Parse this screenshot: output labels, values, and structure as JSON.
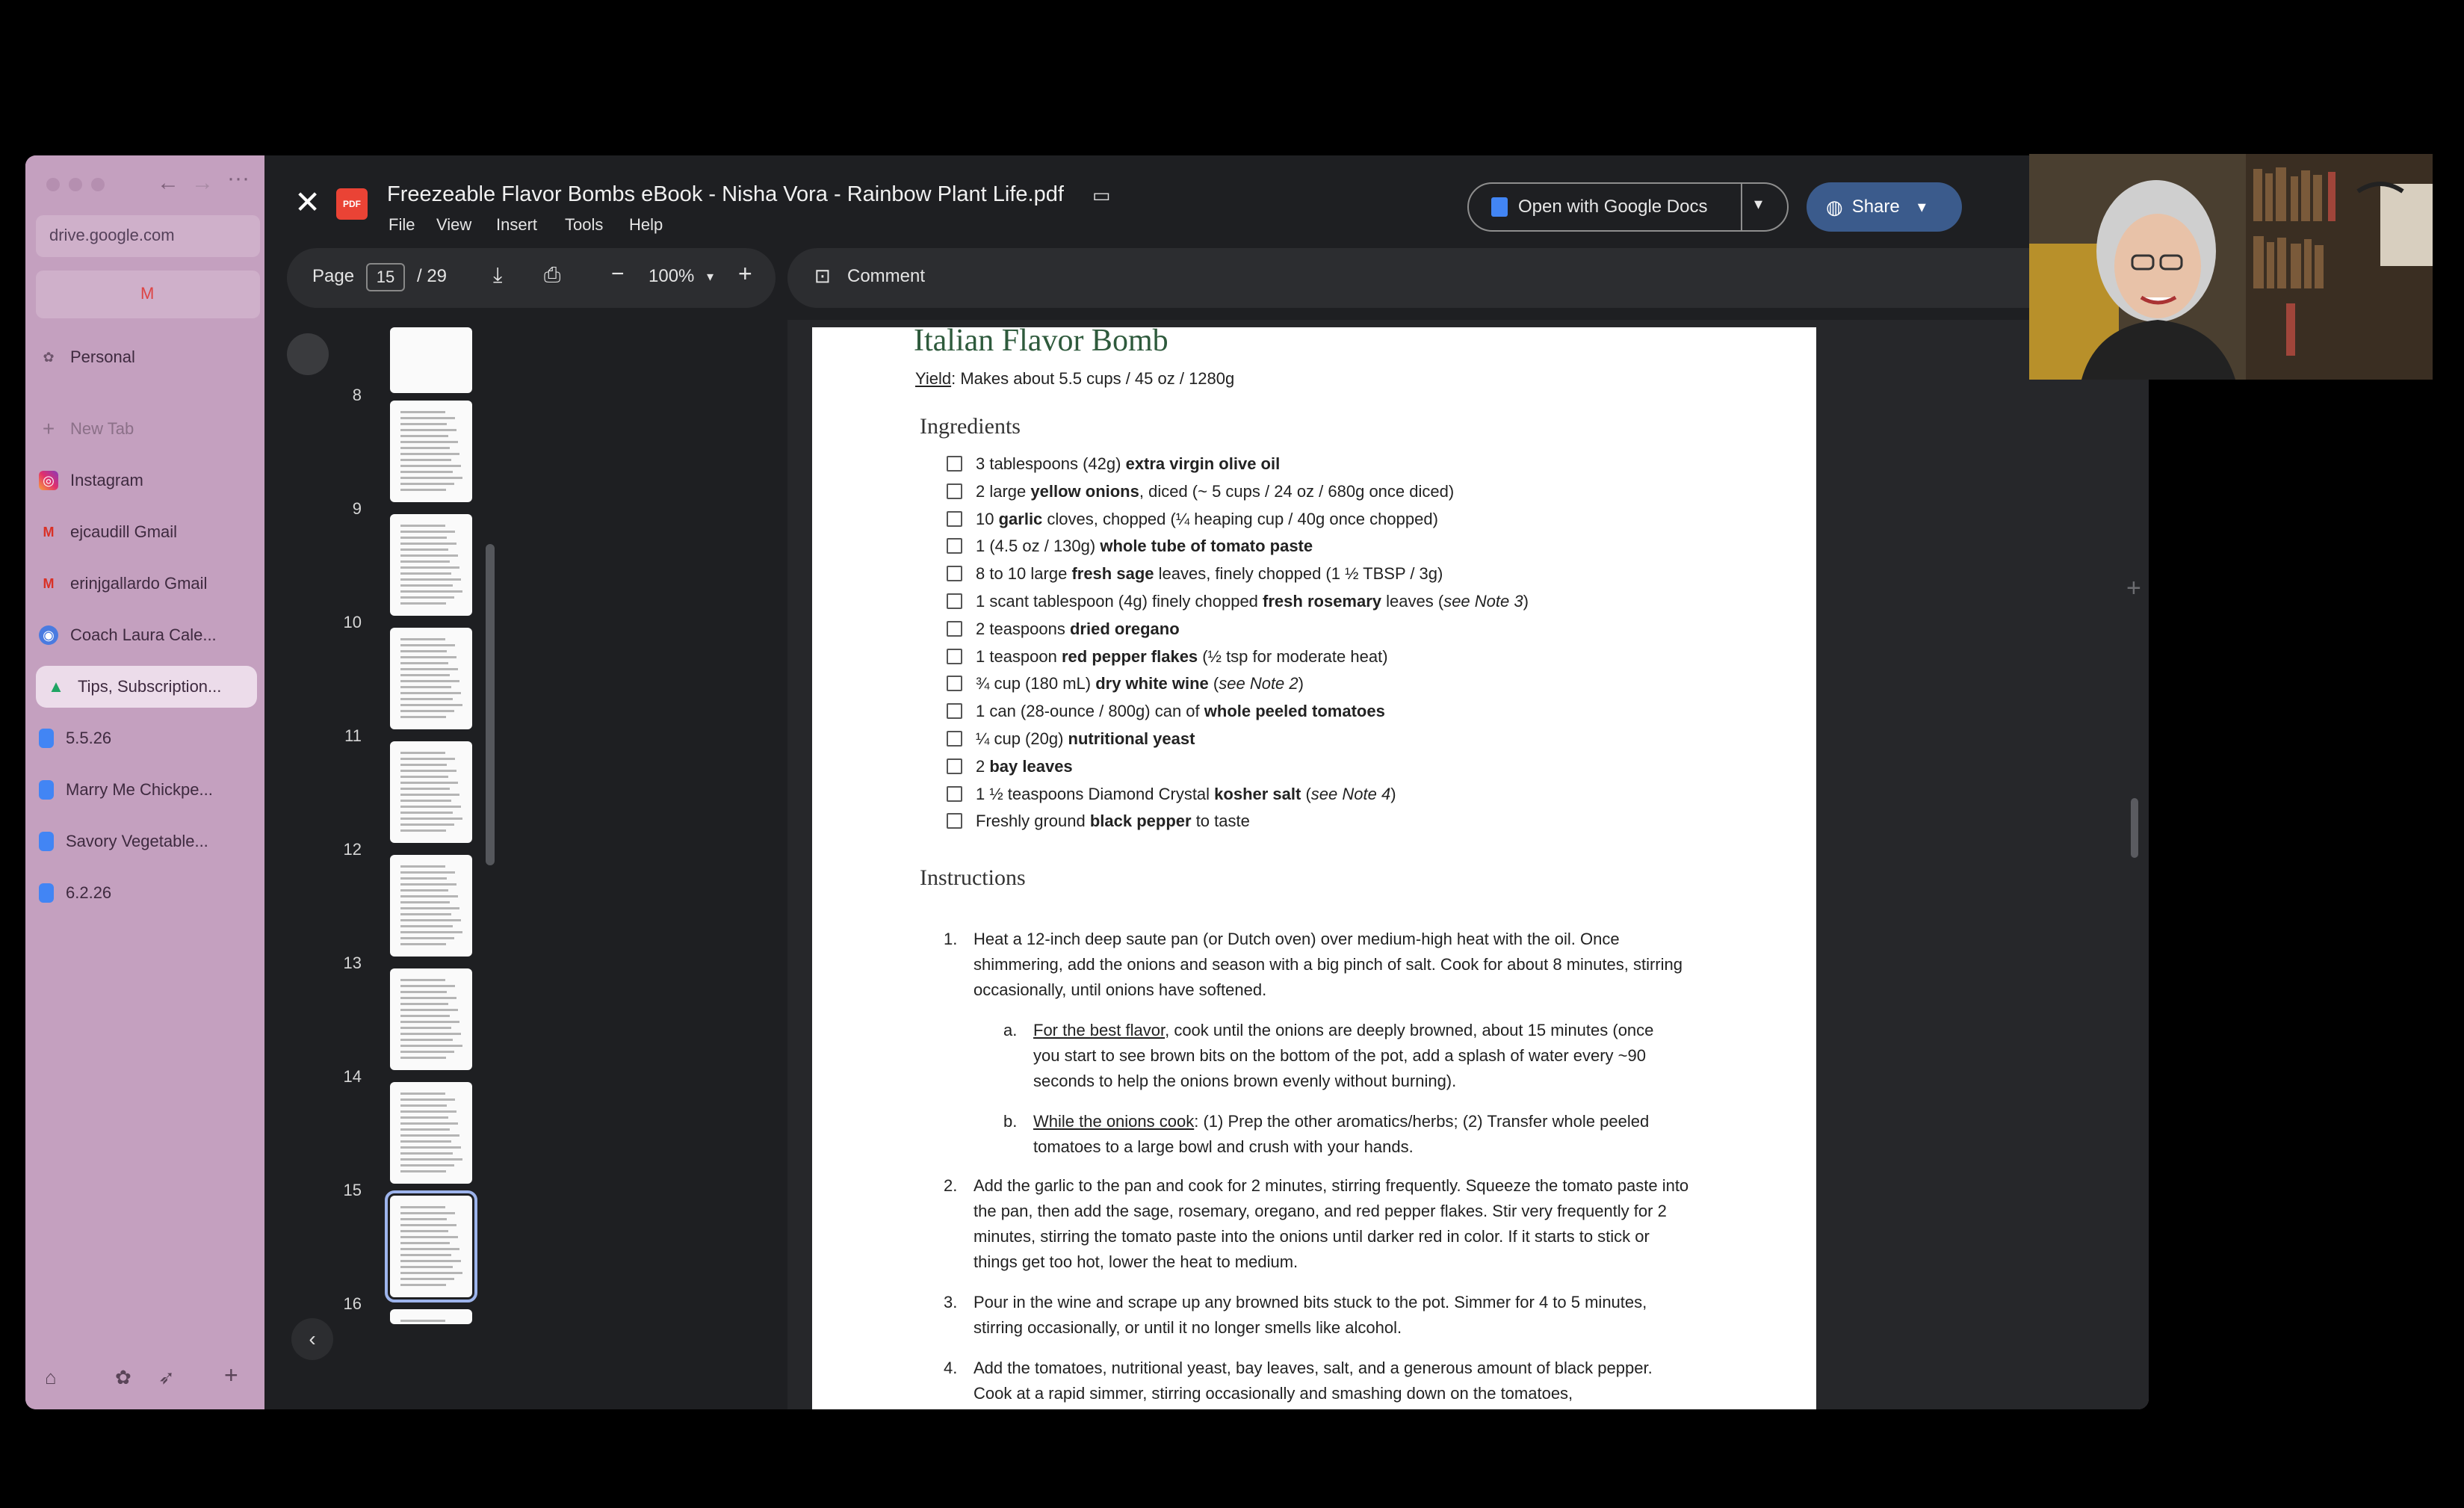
{
  "browser": {
    "url": "drive.google.com",
    "sidebar": {
      "space": "Personal",
      "items": [
        {
          "label": "New Tab",
          "icon": "plus-icon"
        },
        {
          "label": "Instagram",
          "icon": "instagram-icon"
        },
        {
          "label": "ejcaudill Gmail",
          "icon": "gmail-icon"
        },
        {
          "label": "erinjgallardo Gmail",
          "icon": "gmail-icon"
        },
        {
          "label": "Coach Laura Cale...",
          "icon": "calendar-icon"
        },
        {
          "label": "Tips, Subscription...",
          "icon": "google-drive-icon"
        },
        {
          "label": "5.5.26",
          "icon": "google-docs-icon"
        },
        {
          "label": "Marry Me Chickpe...",
          "icon": "google-docs-icon"
        },
        {
          "label": "Savory Vegetable...",
          "icon": "google-docs-icon"
        },
        {
          "label": "6.2.26",
          "icon": "google-docs-icon"
        }
      ]
    }
  },
  "viewer": {
    "title": "Freezeable Flavor Bombs eBook - Nisha Vora - Rainbow Plant Life.pdf",
    "file_badge": "PDF",
    "menu": [
      "File",
      "View",
      "Insert",
      "Tools",
      "Help"
    ],
    "open_with": "Open with Google Docs",
    "share": "Share",
    "toolbar": {
      "page_label": "Page",
      "page_current": "15",
      "page_total": "/ 29",
      "zoom": "100%",
      "comment": "Comment"
    },
    "thumbnails": [
      "8",
      "9",
      "10",
      "11",
      "12",
      "13",
      "14",
      "15",
      "16"
    ]
  },
  "pdf": {
    "title": "Italian Flavor Bomb",
    "yield_label": "Yield",
    "yield_text": ": Makes about 5.5 cups / 45 oz / 1280g",
    "ingredients_heading": "Ingredients",
    "ingredients": [
      {
        "pre": "3 tablespoons (42g) ",
        "bold": "extra virgin olive oil",
        "post": "",
        "note": ""
      },
      {
        "pre": "2 large ",
        "bold": "yellow onions",
        "post": ", diced (~ 5 cups / 24 oz / 680g once diced)",
        "note": ""
      },
      {
        "pre": "10 ",
        "bold": "garlic",
        "post": " cloves, chopped (¼ heaping cup / 40g once chopped)",
        "note": ""
      },
      {
        "pre": "1 (4.5 oz / 130g) ",
        "bold": "whole tube of tomato paste",
        "post": "",
        "note": ""
      },
      {
        "pre": "8 to 10 large ",
        "bold": "fresh sage",
        "post": " leaves, finely chopped (1 ½ TBSP / 3g)",
        "note": ""
      },
      {
        "pre": "1 scant tablespoon (4g) finely chopped ",
        "bold": "fresh rosemary",
        "post": " leaves (",
        "note": "see Note 3",
        "close": ")"
      },
      {
        "pre": "2 teaspoons ",
        "bold": "dried oregano",
        "post": "",
        "note": ""
      },
      {
        "pre": "1 teaspoon ",
        "bold": "red pepper flakes",
        "post": " (½ tsp for moderate heat)",
        "note": ""
      },
      {
        "pre": "¾ cup (180 mL) ",
        "bold": "dry white wine",
        "post": " (",
        "note": "see Note 2",
        "close": ")"
      },
      {
        "pre": "1 can (28-ounce / 800g) can of ",
        "bold": "whole peeled tomatoes",
        "post": "",
        "note": ""
      },
      {
        "pre": "¼ cup (20g) ",
        "bold": "nutritional yeast",
        "post": "",
        "note": ""
      },
      {
        "pre": "2 ",
        "bold": "bay leaves",
        "post": "",
        "note": ""
      },
      {
        "pre": "1 ½ teaspoons Diamond Crystal ",
        "bold": "kosher salt",
        "post": " (",
        "note": "see Note 4",
        "close": ")"
      },
      {
        "pre": "Freshly ground ",
        "bold": "black pepper",
        "post": " to taste",
        "note": ""
      }
    ],
    "instructions_heading": "Instructions",
    "steps": [
      {
        "n": "1.",
        "text": "Heat a 12-inch deep saute pan (or Dutch oven) over medium-high heat with the oil. Once shimmering, add the onions and season with a big pinch of salt. Cook for about 8 minutes, stirring occasionally, until onions have softened."
      },
      {
        "n": "a.",
        "lead": "For the best flavor",
        "text": ", cook until the onions are deeply browned, about 15 minutes (once you start to see brown bits on the bottom of the pot, add a splash of water every ~90 seconds to help the onions brown evenly without burning)."
      },
      {
        "n": "b.",
        "lead": "While the onions cook",
        "text": ": (1) Prep the other aromatics/herbs; (2) Transfer whole peeled tomatoes to a large bowl and crush with your hands."
      },
      {
        "n": "2.",
        "text": "Add the garlic to the pan and cook for 2 minutes, stirring frequently. Squeeze the tomato paste into the pan, then add the sage, rosemary, oregano, and red pepper flakes. Stir very frequently for 2 minutes, stirring the tomato paste into the onions until darker red in color. If it starts to stick or things get too hot, lower the heat to medium."
      },
      {
        "n": "3.",
        "text": "Pour in the wine and scrape up any browned bits stuck to the pot. Simmer for 4 to 5 minutes, stirring occasionally, or until it no longer smells like alcohol."
      },
      {
        "n": "4.",
        "text": "Add the tomatoes, nutritional yeast, bay leaves, salt, and a generous amount of black pepper. Cook at a rapid simmer, stirring occasionally and smashing down on the tomatoes,"
      }
    ]
  },
  "colors": {
    "sidebar_bg": "#c4a0bf",
    "viewer_bg": "#1e1f22",
    "recipe_title": "#2e5a3c",
    "share_button": "#3b5b8c"
  }
}
